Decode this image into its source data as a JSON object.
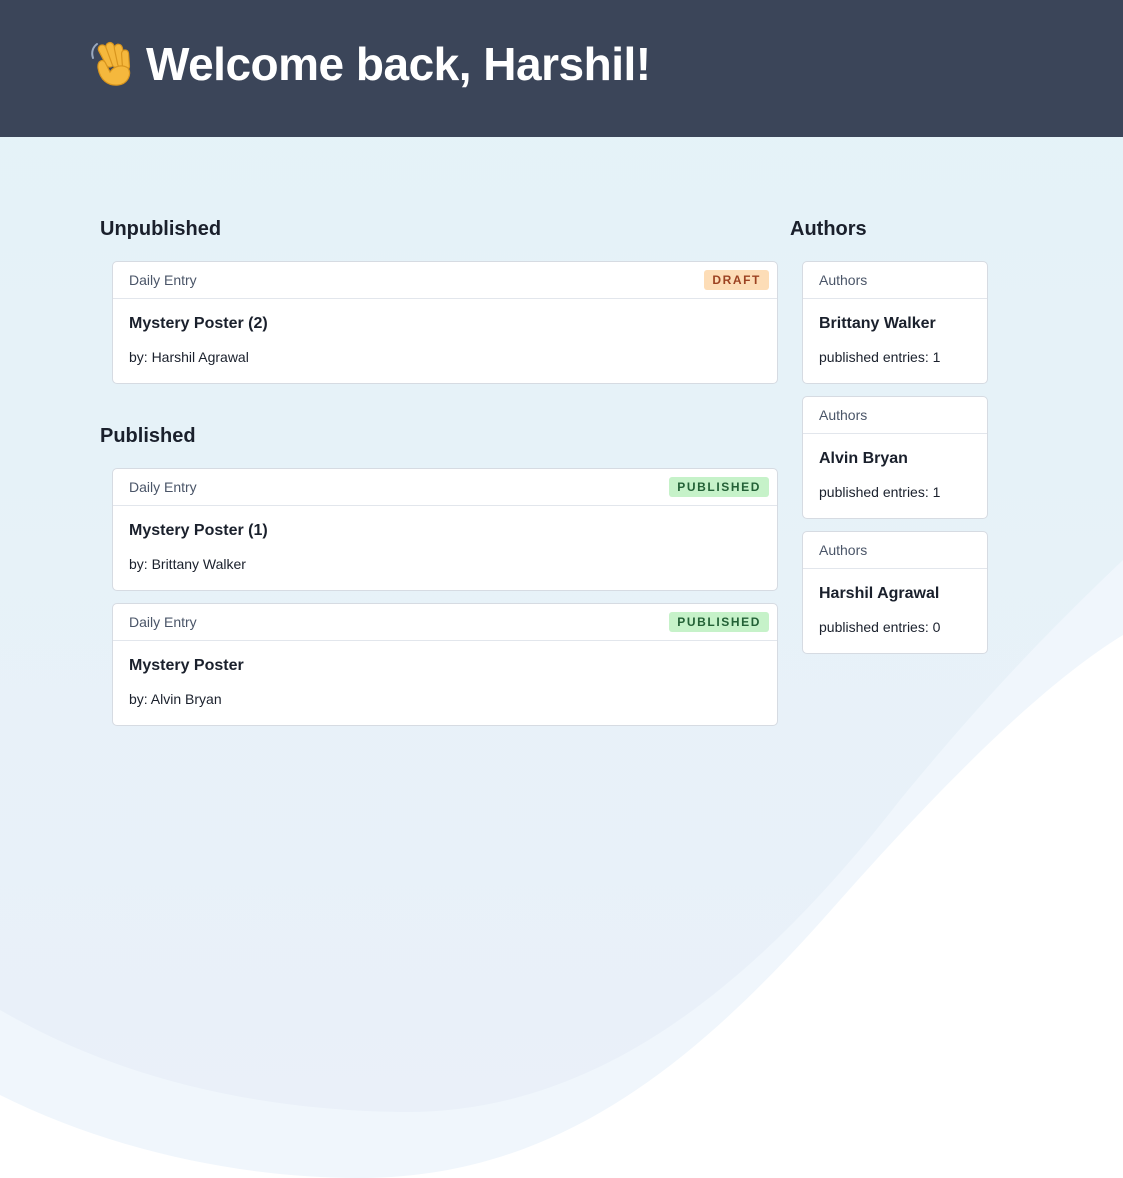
{
  "header": {
    "greeting": "Welcome back, Harshil!"
  },
  "unpublished": {
    "title": "Unpublished",
    "entries": [
      {
        "category": "Daily Entry",
        "status": "DRAFT",
        "title": "Mystery Poster (2)",
        "byline": "by: Harshil Agrawal"
      }
    ]
  },
  "published": {
    "title": "Published",
    "entries": [
      {
        "category": "Daily Entry",
        "status": "PUBLISHED",
        "title": "Mystery Poster (1)",
        "byline": "by: Brittany Walker"
      },
      {
        "category": "Daily Entry",
        "status": "PUBLISHED",
        "title": "Mystery Poster",
        "byline": "by: Alvin Bryan"
      }
    ]
  },
  "authors": {
    "title": "Authors",
    "items": [
      {
        "category": "Authors",
        "name": "Brittany Walker",
        "stats": "published entries: 1"
      },
      {
        "category": "Authors",
        "name": "Alvin Bryan",
        "stats": "published entries: 1"
      },
      {
        "category": "Authors",
        "name": "Harshil Agrawal",
        "stats": "published entries: 0"
      }
    ]
  },
  "colors": {
    "header_bg": "#3b4559",
    "draft_badge_bg": "#fdddb7",
    "draft_badge_text": "#9c4221",
    "published_badge_bg": "#c6f2c9",
    "published_badge_text": "#236136",
    "page_bg_top": "#e4f3f8"
  },
  "icons": {
    "greeting": "waving-hand-icon"
  }
}
